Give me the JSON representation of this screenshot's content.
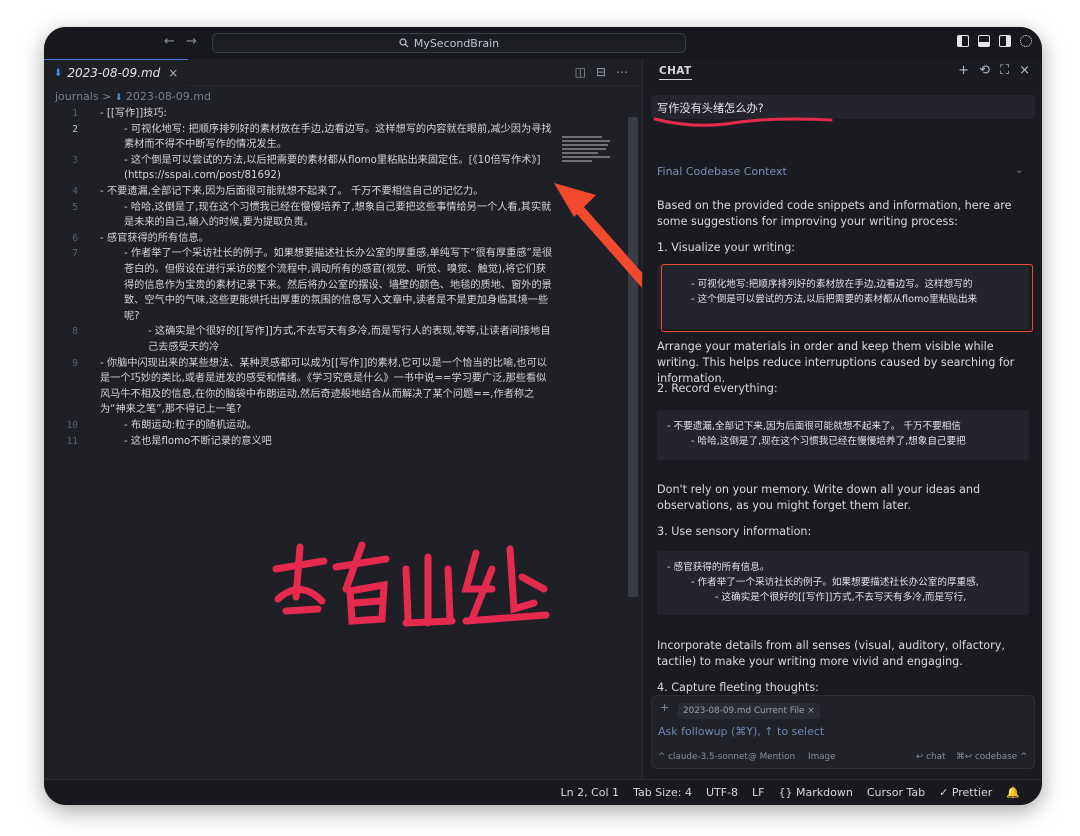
{
  "titlebar": {
    "back": "←",
    "forward": "→",
    "search_label": "MySecondBrain"
  },
  "editor": {
    "tab_label": "2023-08-09.md",
    "tab_close": "×",
    "tab_actions": [
      "◫",
      "⊟",
      "⋯"
    ],
    "breadcrumb": {
      "folder": "journals",
      "separator": ">",
      "file": "2023-08-09.md"
    },
    "lines": [
      {
        "n": "1",
        "text": "- [[写作]]技巧:"
      },
      {
        "n": "2",
        "text": "- 可视化地写: 把顺序排列好的素材放在手边,边看边写。这样想写的内容就在眼前,减少因为寻找素材而不得不中断写作的情况发生。"
      },
      {
        "n": "3",
        "text": "- 这个倒是可以尝试的方法,以后把需要的素材都从flomo里粘贴出来固定住。[《10倍写作术》](https://sspai.com/post/81692)"
      },
      {
        "n": "4",
        "text": "- 不要遗漏,全部记下来,因为后面很可能就想不起来了。 千万不要相信自己的记忆力。"
      },
      {
        "n": "5",
        "text": "- 哈哈,这倒是了,现在这个习惯我已经在慢慢培养了,想象自己要把这些事情给另一个人看,其实就是未来的自己,输入的时候,要为提取负责。"
      },
      {
        "n": "6",
        "text": "- 感官获得的所有信息。"
      },
      {
        "n": "7",
        "text": "- 作者举了一个采访社长的例子。如果想要描述社长办公室的厚重感,单纯写下“很有厚重感”是很苍白的。但假设在进行采访的整个流程中,调动所有的感官(视觉、听觉、嗅觉、触觉),将它们获得的信息作为宝贵的素材记录下来。然后将办公室的摆设、墙壁的颜色、地毯的质地、窗外的景致、空气中的气味,这些更能烘托出厚重的氛围的信息写入文章中,读者是不是更加身临其境一些呢?"
      },
      {
        "n": "8",
        "text": "- 这确实是个很好的[[写作]]方式,不去写天有多冷,而是写行人的表现,等等,让读者间接地自己去感受天的冷"
      },
      {
        "n": "9",
        "text": "- 你脑中闪现出来的某些想法、某种灵感都可以成为[[写作]]的素材,它可以是一个恰当的比喻,也可以是一个巧妙的类比,或者是迸发的感受和情绪。《学习究竟是什么》一书中说==学习要广泛,那些看似风马牛不相及的信息,在你的脑袋中布朗运动,然后奇迹般地结合从而解决了某个问题==,作者称之为“神来之笔”,那不得记上一笔?"
      },
      {
        "n": "10",
        "text": "- 布朗运动:粒子的随机运动。"
      },
      {
        "n": "11",
        "text": "- 这也是flomo不断记录的意义吧"
      }
    ],
    "annotation": "查看出处"
  },
  "chat": {
    "header": "CHAT",
    "actions": [
      "+",
      "⟲",
      "⛶",
      "×"
    ],
    "question": "写作没有头绪怎么办?",
    "context_label": "Final Codebase Context",
    "intro": "Based on the provided code snippets and information, here are some suggestions for improving your writing process:",
    "sections": [
      {
        "heading": "1. Visualize your writing:",
        "code": [
          "- 可视化地写:把顺序排列好的素材放在手边,边看边写。这样想写的",
          "- 这个倒是可以尝试的方法,以后把需要的素材都从flomo里粘贴出来"
        ],
        "text": "Arrange your materials in order and keep them visible while writing. This helps reduce interruptions caused by searching for information."
      },
      {
        "heading": "2. Record everything:",
        "code": [
          "- 不要遗漏,全部记下来,因为后面很可能就想不起来了。  千万不要相信",
          "- 哈哈,这倒是了,现在这个习惯我已经在慢慢培养了,想象自己要把"
        ],
        "text": "Don't rely on your memory. Write down all your ideas and observations, as you might forget them later."
      },
      {
        "heading": "3. Use sensory information:",
        "code": [
          "- 感官获得的所有信息。",
          "- 作者举了一个采访社长的例子。如果想要描述社长办公室的厚重感,",
          "- 这确实是个很好的[[写作]]方式,不去写天有多冷,而是写行,"
        ],
        "text": "Incorporate details from all senses (visual, auditory, olfactory, tactile) to make your writing more vivid and engaging."
      },
      {
        "heading": "4. Capture fleeting thoughts:"
      }
    ],
    "composer": {
      "plus": "+",
      "file_pill": "2023-08-09.md Current File ×",
      "placeholder": "Ask followup (⌘Y), ↑ to select",
      "model": "^ claude-3.5-sonnet",
      "mention": "@ Mention",
      "image": "Image",
      "chat_hint": "↩ chat",
      "codebase_hint": "⌘↩ codebase ^"
    }
  },
  "status": {
    "items": [
      "Ln 2, Col 1",
      "Tab Size: 4",
      "UTF-8",
      "LF",
      "{} Markdown",
      "Cursor Tab",
      "✓ Prettier",
      "🔔"
    ]
  }
}
